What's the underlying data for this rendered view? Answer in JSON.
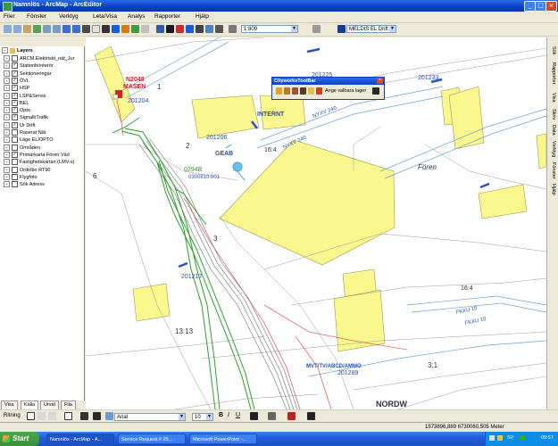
{
  "window": {
    "title": "Namnlös - ArcMap - ArcEditor",
    "controls": [
      "_",
      "□",
      "×"
    ]
  },
  "menu": [
    "Filer",
    "Fönster",
    "Verktyg",
    "Leta/Visa",
    "Analys",
    "Rapporter",
    "Hjälp"
  ],
  "toolbar": {
    "scale": "1:809",
    "editor_label": "MELDIS EL Drift"
  },
  "toc": {
    "root": "Layers",
    "layers": [
      {
        "label": "ARCM.Elektriskt_nät_Jur",
        "checked": false
      },
      {
        "label": "Stationbönterör",
        "checked": true
      },
      {
        "label": "Sektioneringar",
        "checked": true
      },
      {
        "label": "ÖVL",
        "checked": true
      },
      {
        "label": "HSP",
        "checked": true
      },
      {
        "label": "LSP&Servis",
        "checked": true
      },
      {
        "label": "BEL",
        "checked": true
      },
      {
        "label": "Opto",
        "checked": true
      },
      {
        "label": "SignalbTrafik",
        "checked": true
      },
      {
        "label": "Ur Drift",
        "checked": true
      },
      {
        "label": "Raserat Nät",
        "checked": false
      },
      {
        "label": "Läge EL/OPTO",
        "checked": false
      },
      {
        "label": "Områden",
        "checked": false
      },
      {
        "label": "Primärkarta Fören Väd",
        "checked": true
      },
      {
        "label": "Fastighetskartan (LMV-s)",
        "checked": false
      },
      {
        "label": "Ordelbo RT90",
        "checked": false
      },
      {
        "label": "Flygfoto",
        "checked": false
      },
      {
        "label": "Sök Adress",
        "checked": false
      }
    ],
    "tabs": [
      "Visa",
      "Källa",
      "Urval",
      "Fila"
    ]
  },
  "floating_toolbar": {
    "title": "CityworksToolBar",
    "prompt": "Ange valbara lager"
  },
  "map_labels": {
    "n2048": "N2048",
    "masen": "MASEN",
    "b201204": "201204",
    "b201206": "201206",
    "b201217": "201217",
    "b201225": "201225",
    "b201233": "201233",
    "b201289": "201289",
    "internt": "INTERNT",
    "geab": "GEAB",
    "n0294": "0294B",
    "code": "0300810:001",
    "foren": "Fören",
    "n164a": "16:4",
    "n164b": "16:4",
    "n1313": "13:13",
    "n31": "3:1",
    "n1": "1",
    "n2": "2",
    "n3": "3",
    "n6": "6",
    "vattendamm": "MVT/TV/ABCD/AMMO",
    "nordvxl": "NORDW",
    "road1": "NYXV 240",
    "road2": "NYXV 240",
    "road3": "FKXU 10",
    "road4": "FKXU 10"
  },
  "drawing": {
    "label": "Ritning",
    "font": "Arial",
    "size": "10"
  },
  "status": {
    "coords": "1573896,889  6730060,505 Meter"
  },
  "taskbar": {
    "start": "Start",
    "tasks": [
      "Namnlös - ArcMap - A...",
      "Service Request # 25...",
      "Microsoft PowerPoint -..."
    ],
    "lang": "SV",
    "time": "09:57"
  },
  "right_tabs": [
    "Sök",
    "Rapporter",
    "Visa",
    "Skriv",
    "Data",
    "Verktyg",
    "Fönster",
    "Hjälp"
  ]
}
